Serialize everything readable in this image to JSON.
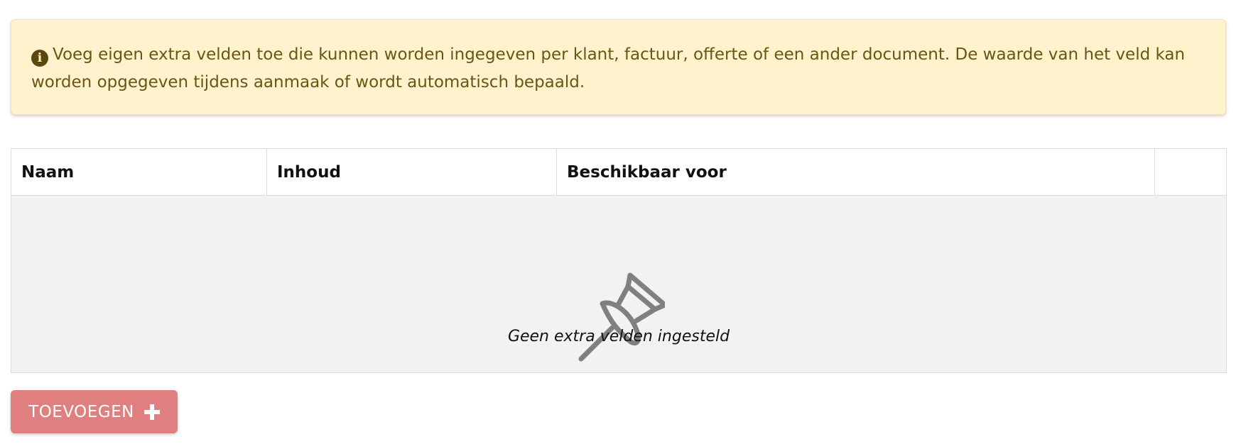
{
  "alert": {
    "icon": "info-circle-icon",
    "text": "Voeg eigen extra velden toe die kunnen worden ingegeven per klant, factuur, offerte of een ander document. De waarde van het veld kan worden opgegeven tijdens aanmaak of wordt automatisch bepaald."
  },
  "table": {
    "columns": [
      "Naam",
      "Inhoud",
      "Beschikbaar voor",
      ""
    ],
    "empty_icon": "pushpin-icon",
    "empty_message": "Geen extra velden ingesteld"
  },
  "actions": {
    "add_label": "TOEVOEGEN",
    "add_icon": "plus-icon"
  },
  "colors": {
    "alert_background": "#fff2cc",
    "alert_text": "#6b5512",
    "empty_background": "#f2f2f2",
    "add_button": "#e07f7f"
  }
}
